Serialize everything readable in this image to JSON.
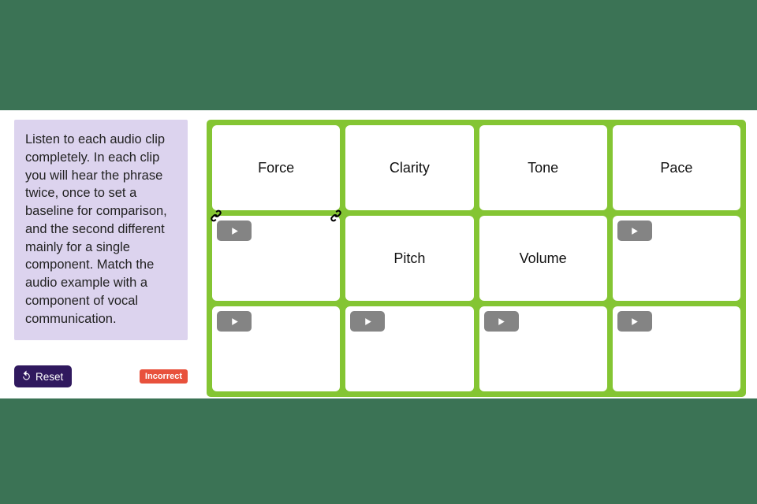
{
  "instructions": "Listen to each audio clip completely. In each clip you will hear the phrase twice, once to set a baseline for comparison, and the second different mainly for a single component. Match the audio example with a component of vocal communication.",
  "reset_label": "Reset",
  "status_label": "Incorrect",
  "cards": {
    "r0c0": "Force",
    "r0c1": "Clarity",
    "r0c2": "Tone",
    "r0c3": "Pace",
    "r1c1": "Pitch",
    "r1c2": "Volume"
  },
  "colors": {
    "quiz_bg": "#84c533",
    "header_green": "#3b7355",
    "instr_bg": "#dcd3ee",
    "reset_bg": "#30195e",
    "status_bg": "#e8513c"
  }
}
